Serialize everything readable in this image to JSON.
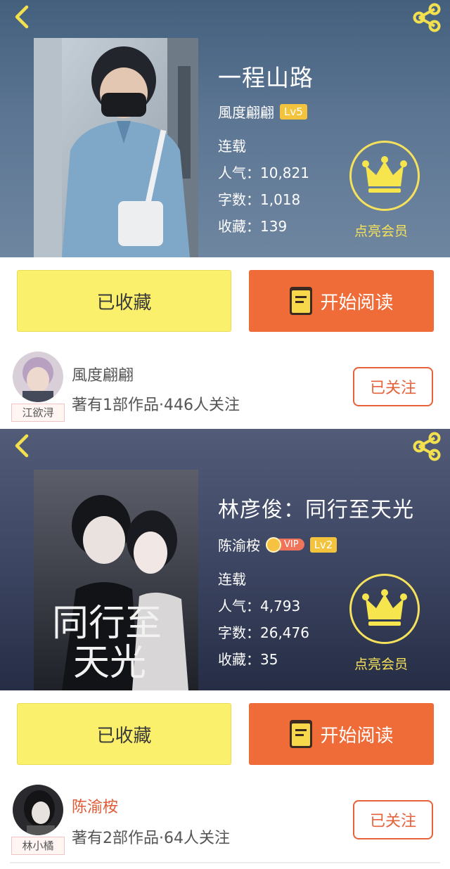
{
  "books": [
    {
      "title": "一程山路",
      "author": "風度翩翩",
      "level": "Lv5",
      "has_vip": false,
      "status": "连载",
      "popularity": "人气：10,821",
      "word_count": "字数：1,018",
      "favorites": "收藏：139",
      "member_label": "点亮会员",
      "fav_button": "已收藏",
      "read_button": "开始阅读",
      "writer_name": "風度翩翩",
      "writer_meta": "著有1部作品·446人关注",
      "avatar_tag": "江欲浔",
      "follow_button": "已关注"
    },
    {
      "title": "林彦俊：同行至天光",
      "author": "陈渝桉",
      "level": "Lv2",
      "has_vip": true,
      "vip_text": "VIP",
      "status": "连载",
      "popularity": "人气：4,793",
      "word_count": "字数：26,476",
      "favorites": "收藏：35",
      "member_label": "点亮会员",
      "fav_button": "已收藏",
      "read_button": "开始阅读",
      "writer_name": "陈渝桉",
      "writer_meta": "著有2部作品·64人关注",
      "avatar_tag": "林小橘",
      "follow_button": "已关注",
      "cover_text_line1": "同行至",
      "cover_text_line2": "天光"
    }
  ],
  "icons": [
    "chevron-left-icon",
    "share-icon",
    "crown-icon",
    "book-icon"
  ],
  "colors": {
    "accent_orange": "#ef6b37",
    "fav_yellow": "#fbf06c",
    "vip_gold": "#f5e15c",
    "level_badge": "#f4c33e"
  }
}
